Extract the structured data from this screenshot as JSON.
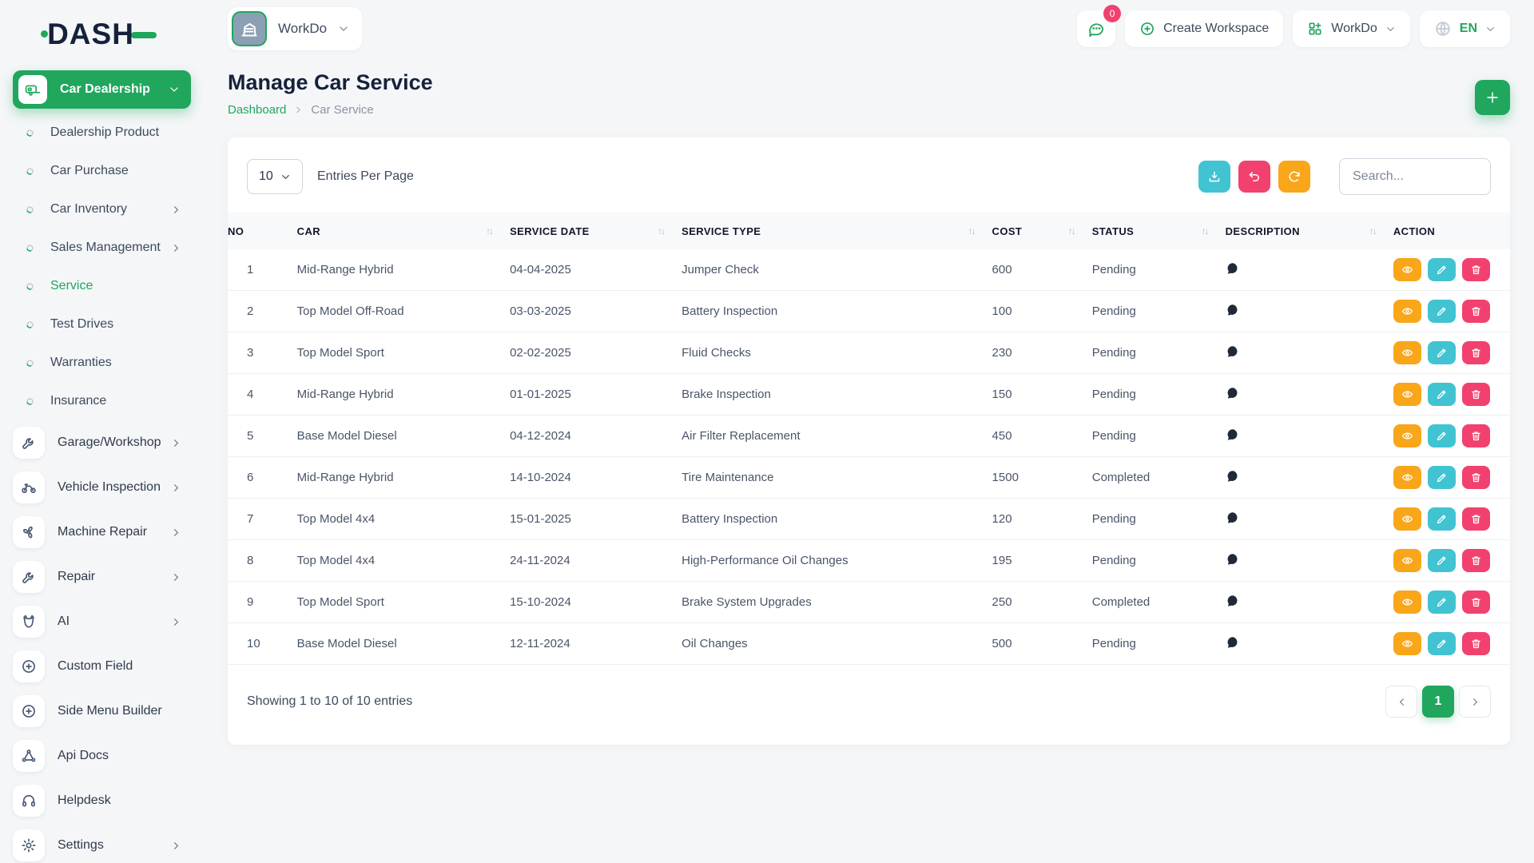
{
  "brand": {
    "logo_text": "DASH"
  },
  "colors": {
    "primary_green": "#21a65e",
    "teal": "#41c3d2",
    "pink": "#f2416e",
    "orange": "#f9a61a",
    "navy": "#16223b"
  },
  "header": {
    "workspace": {
      "name": "WorkDo",
      "avatar_icon": "building",
      "chevron_icon": "chevron-down"
    },
    "messages": {
      "icon": "chat",
      "badge": "0"
    },
    "create_workspace": {
      "icon": "plus-circle",
      "label": "Create Workspace"
    },
    "workspace_switcher": {
      "icon": "grid-plus",
      "label": "WorkDo",
      "chevron_icon": "chevron-down"
    },
    "language": {
      "icon": "globe",
      "label": "EN",
      "chevron_icon": "chevron-down"
    }
  },
  "page": {
    "title": "Manage Car Service",
    "breadcrumb": {
      "home": "Dashboard",
      "separator_icon": "chevron-right",
      "current": "Car Service"
    },
    "add_icon": "plus"
  },
  "sidebar": {
    "active_module": {
      "label": "Car Dealership",
      "icon": "caravan",
      "chevron_icon": "chevron-down"
    },
    "sub_items": [
      {
        "label": "Dealership Product",
        "icon": "dot",
        "has_children": false,
        "active": false
      },
      {
        "label": "Car Purchase",
        "icon": "dot",
        "has_children": false,
        "active": false
      },
      {
        "label": "Car Inventory",
        "icon": "dot",
        "has_children": true,
        "active": false
      },
      {
        "label": "Sales Management",
        "icon": "dot",
        "has_children": true,
        "active": false
      },
      {
        "label": "Service",
        "icon": "dot",
        "has_children": false,
        "active": true
      },
      {
        "label": "Test Drives",
        "icon": "dot",
        "has_children": false,
        "active": false
      },
      {
        "label": "Warranties",
        "icon": "dot",
        "has_children": false,
        "active": false
      },
      {
        "label": "Insurance",
        "icon": "dot",
        "has_children": false,
        "active": false
      }
    ],
    "items": [
      {
        "label": "Garage/Workshop",
        "icon": "wrench",
        "has_children": true
      },
      {
        "label": "Vehicle Inspection",
        "icon": "motorcycle",
        "has_children": true
      },
      {
        "label": "Machine Repair",
        "icon": "fan",
        "has_children": true
      },
      {
        "label": "Repair",
        "icon": "wrench",
        "has_children": true
      },
      {
        "label": "AI",
        "icon": "ai",
        "has_children": true
      },
      {
        "label": "Custom Field",
        "icon": "plus-circle",
        "has_children": false
      },
      {
        "label": "Side Menu Builder",
        "icon": "plus-circle",
        "has_children": false
      },
      {
        "label": "Api Docs",
        "icon": "api",
        "has_children": false
      },
      {
        "label": "Helpdesk",
        "icon": "headphones",
        "has_children": false
      },
      {
        "label": "Settings",
        "icon": "gear",
        "has_children": true
      }
    ]
  },
  "toolbar": {
    "page_size": "10",
    "page_size_chevron_icon": "chevron-down",
    "entries_label": "Entries Per Page",
    "export": {
      "icon": "download"
    },
    "reset": {
      "icon": "undo"
    },
    "refresh": {
      "icon": "refresh"
    },
    "search_placeholder": "Search..."
  },
  "table": {
    "sort_glyph": "↑↓",
    "description_icon": "chat-filled",
    "columns": [
      {
        "label": "NO",
        "sortable": false
      },
      {
        "label": "CAR",
        "sortable": true
      },
      {
        "label": "SERVICE DATE",
        "sortable": true
      },
      {
        "label": "SERVICE TYPE",
        "sortable": true
      },
      {
        "label": "COST",
        "sortable": true
      },
      {
        "label": "STATUS",
        "sortable": true
      },
      {
        "label": "DESCRIPTION",
        "sortable": true
      },
      {
        "label": "ACTION",
        "sortable": false
      }
    ],
    "row_actions": [
      {
        "name": "view",
        "icon": "eye"
      },
      {
        "name": "edit",
        "icon": "pencil"
      },
      {
        "name": "delete",
        "icon": "trash"
      }
    ],
    "rows": [
      {
        "no": "1",
        "car": "Mid-Range Hybrid",
        "service_date": "04-04-2025",
        "service_type": "Jumper Check",
        "cost": "600",
        "status": "Pending"
      },
      {
        "no": "2",
        "car": "Top Model Off-Road",
        "service_date": "03-03-2025",
        "service_type": "Battery Inspection",
        "cost": "100",
        "status": "Pending"
      },
      {
        "no": "3",
        "car": "Top Model Sport",
        "service_date": "02-02-2025",
        "service_type": "Fluid Checks",
        "cost": "230",
        "status": "Pending"
      },
      {
        "no": "4",
        "car": "Mid-Range Hybrid",
        "service_date": "01-01-2025",
        "service_type": "Brake Inspection",
        "cost": "150",
        "status": "Pending"
      },
      {
        "no": "5",
        "car": "Base Model Diesel",
        "service_date": "04-12-2024",
        "service_type": "Air Filter Replacement",
        "cost": "450",
        "status": "Pending"
      },
      {
        "no": "6",
        "car": "Mid-Range Hybrid",
        "service_date": "14-10-2024",
        "service_type": "Tire Maintenance",
        "cost": "1500",
        "status": "Completed"
      },
      {
        "no": "7",
        "car": "Top Model 4x4",
        "service_date": "15-01-2025",
        "service_type": "Battery Inspection",
        "cost": "120",
        "status": "Pending"
      },
      {
        "no": "8",
        "car": "Top Model 4x4",
        "service_date": "24-11-2024",
        "service_type": "High-Performance Oil Changes",
        "cost": "195",
        "status": "Pending"
      },
      {
        "no": "9",
        "car": "Top Model Sport",
        "service_date": "15-10-2024",
        "service_type": "Brake System Upgrades",
        "cost": "250",
        "status": "Completed"
      },
      {
        "no": "10",
        "car": "Base Model Diesel",
        "service_date": "12-11-2024",
        "service_type": "Oil Changes",
        "cost": "500",
        "status": "Pending"
      }
    ]
  },
  "footer": {
    "summary": "Showing 1 to 10 of 10 entries",
    "pagination": {
      "prev_icon": "chevron-left",
      "current": "1",
      "next_icon": "chevron-right"
    }
  }
}
